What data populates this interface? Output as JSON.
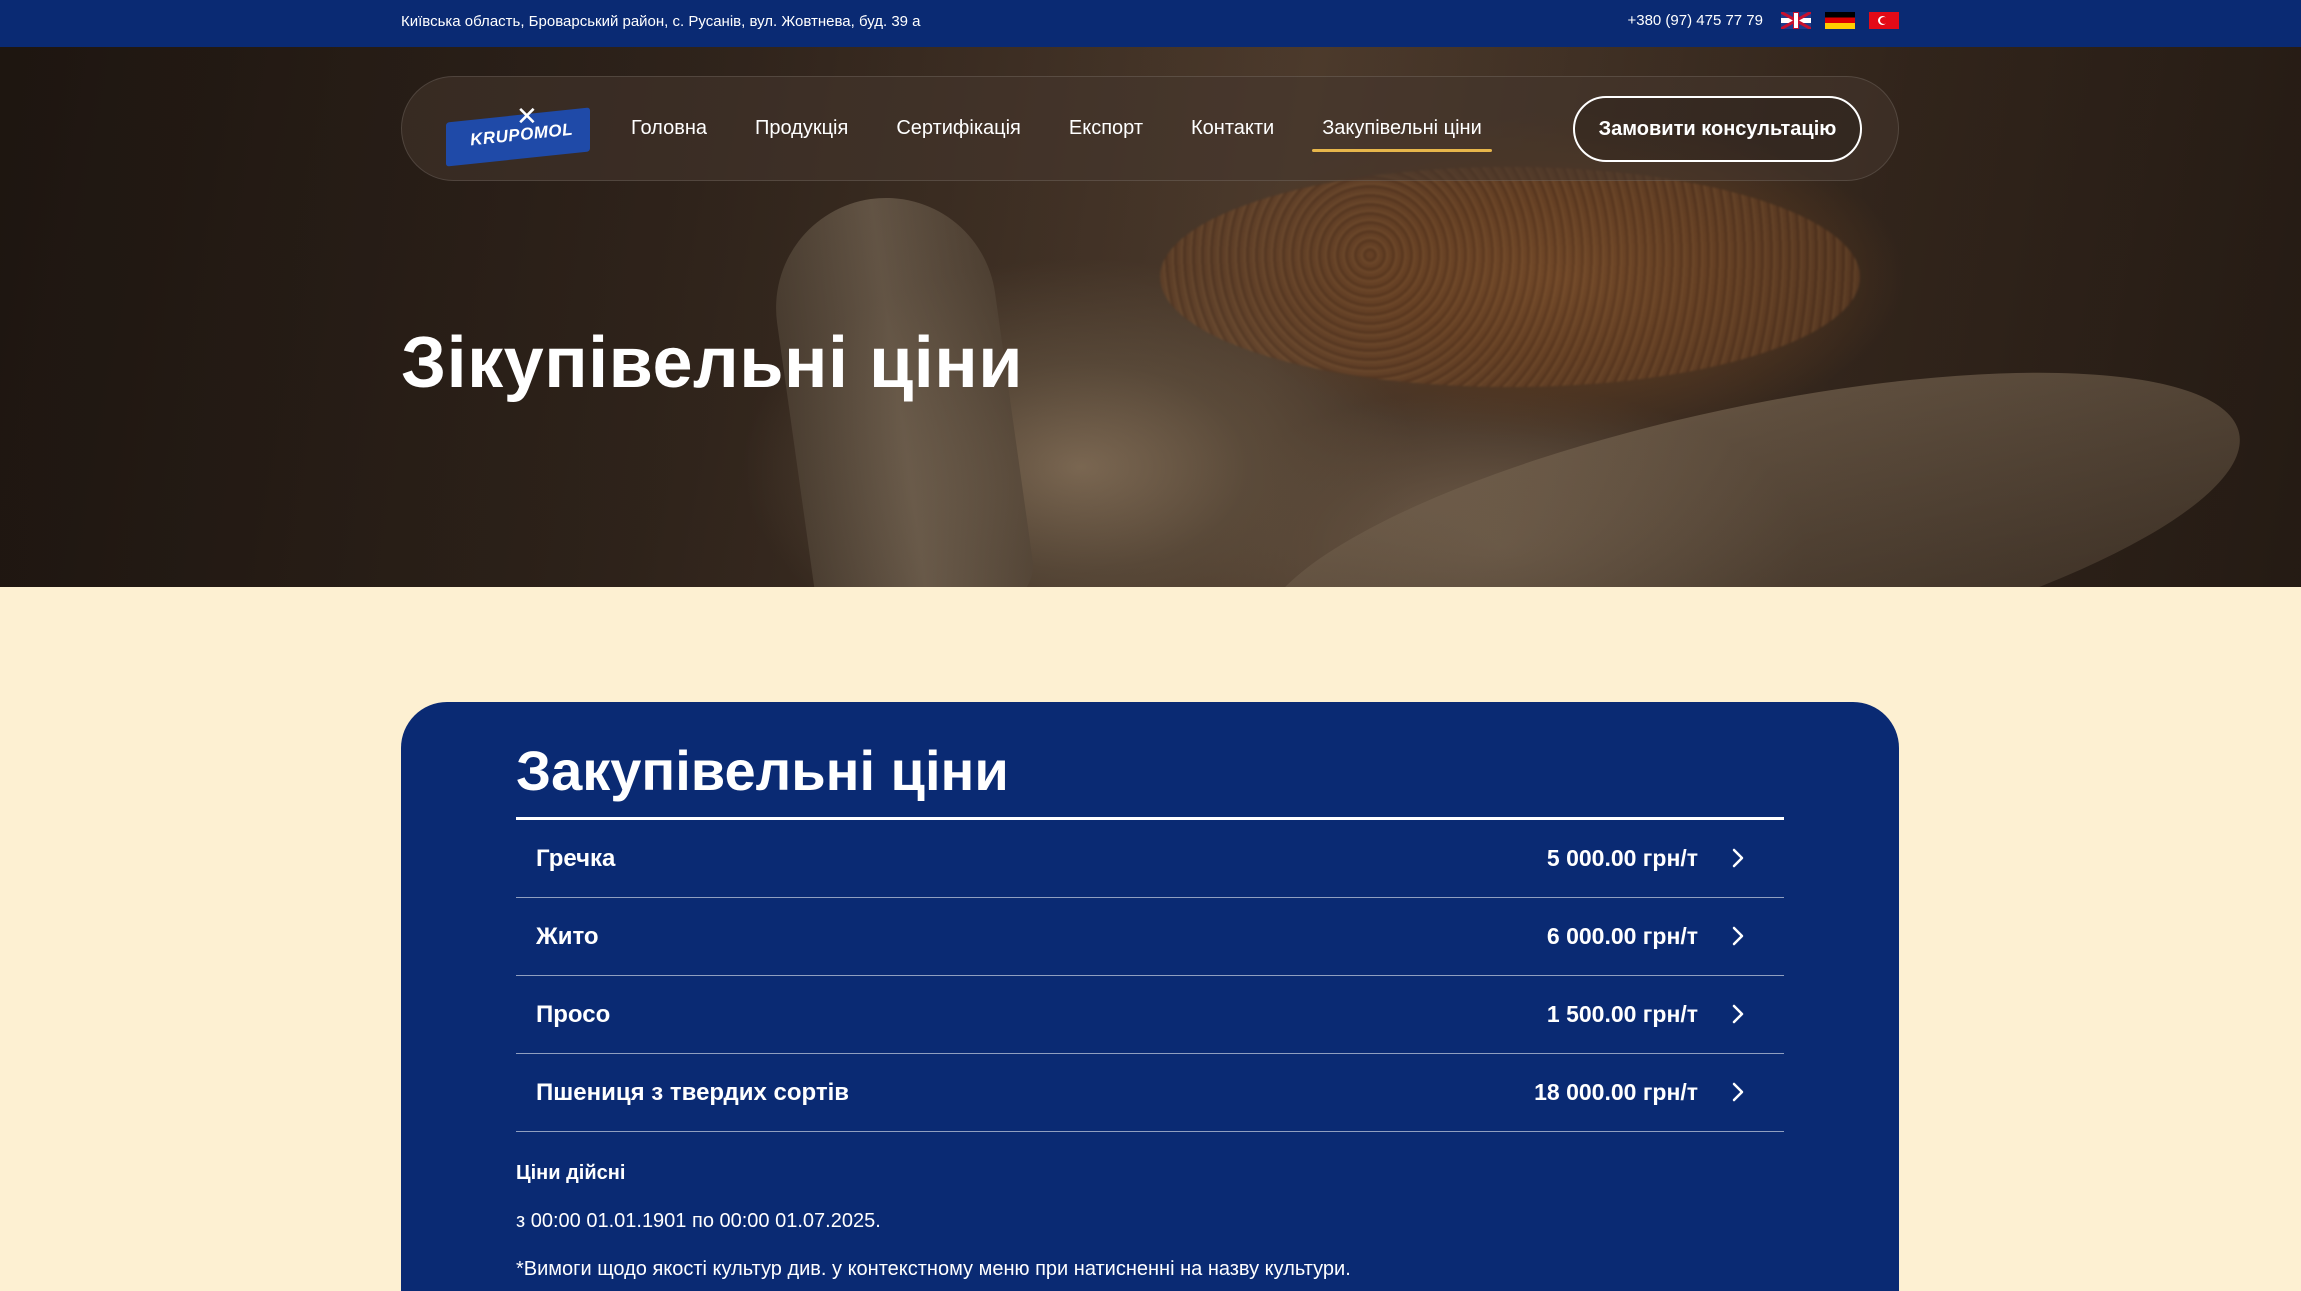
{
  "topbar": {
    "address": "Київська область, Броварський район, с. Русанів, вул. Жовтнева, буд. 39 а",
    "phone": "+380 (97) 475 77 79",
    "languages": [
      "english-flag",
      "german-flag",
      "turkish-flag"
    ]
  },
  "brand": {
    "logo_text": "KRUPOMOL"
  },
  "nav": {
    "items": [
      "Головна",
      "Продукція",
      "Сертифікація",
      "Експорт",
      "Контакти",
      "Закупівельні ціни"
    ],
    "active_index": 5,
    "cta_label": "Замовити консультацію"
  },
  "hero": {
    "title": "Зікупівельні ціни"
  },
  "prices": {
    "title": "Закупівельні ціни",
    "rows": [
      {
        "name": "Гречка",
        "price": "5 000.00 грн/т"
      },
      {
        "name": "Жито",
        "price": "6 000.00 грн/т"
      },
      {
        "name": "Просо",
        "price": "1 500.00 грн/т"
      },
      {
        "name": "Пшениця з твердих сортів",
        "price": "18 000.00 грн/т"
      }
    ],
    "validity_label": "Ціни дійсні",
    "validity_range": "з 00:00 01.01.1901 по 00:00 01.07.2025.",
    "quality_note": "*Вимоги щодо якості культур див. у контекстному меню при натисненні на назву культури."
  },
  "colors": {
    "navy": "#0a2a73",
    "cream": "#fdf0d2",
    "accent": "#e7b64b"
  }
}
